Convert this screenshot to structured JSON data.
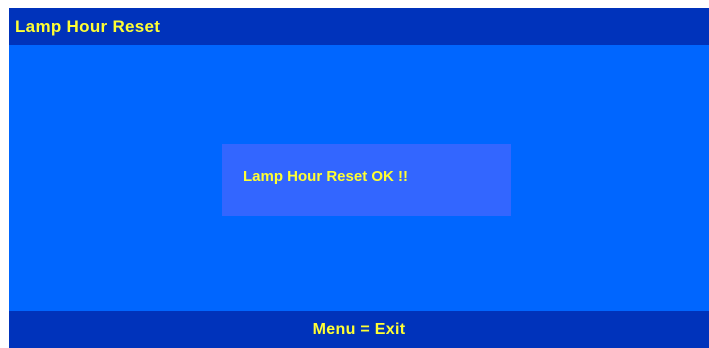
{
  "colors": {
    "background": "#0066ff",
    "bar": "#0033bb",
    "message_box": "#3366ff",
    "text": "#ffff33"
  },
  "title_bar": {
    "title": "Lamp Hour Reset"
  },
  "message": {
    "text": "Lamp Hour Reset OK !!"
  },
  "footer": {
    "hint": "Menu = Exit"
  }
}
